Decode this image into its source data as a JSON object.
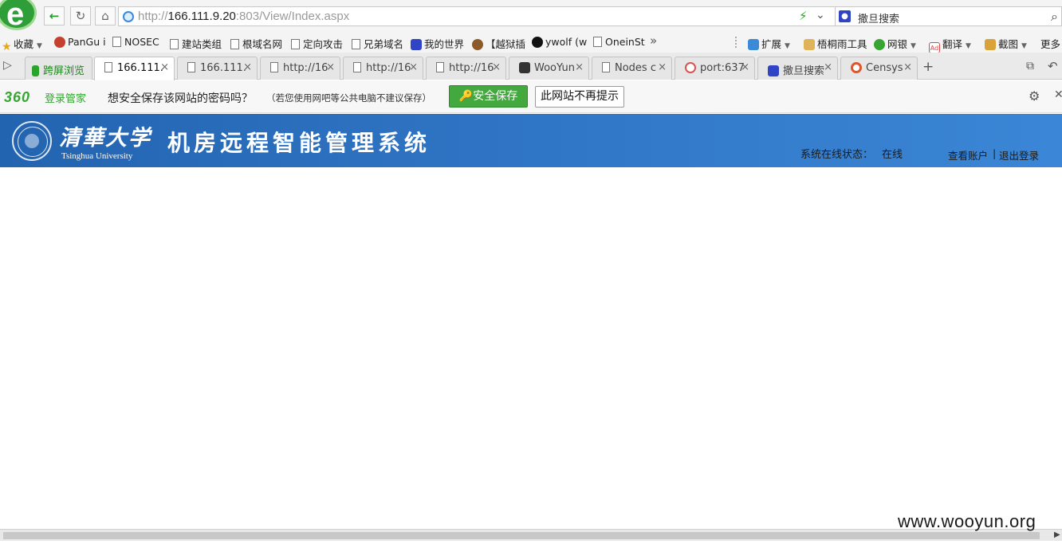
{
  "browser": {
    "logo_glyph": "e",
    "url_scheme": "http://",
    "url_host": "166.111.9.20",
    "url_rest": ":803/View/Index.aspx",
    "search_text": "撒旦搜索",
    "icons": [
      "back-icon",
      "refresh-icon",
      "home-icon",
      "globe-icon",
      "lightning-icon",
      "chevron-down-icon",
      "search-icon"
    ]
  },
  "bookmarks": {
    "left": [
      "收藏",
      "PanGu i",
      "NOSEC",
      "建站类组",
      "根域名网",
      "定向攻击",
      "兄弟域名",
      "我的世界",
      "【越狱插",
      "ywolf (w",
      "OneinSt"
    ],
    "more_glyph": "»",
    "right": [
      "扩展",
      "梧桐雨工具",
      "网银",
      "翻译",
      "截图",
      "更多"
    ]
  },
  "tabs": {
    "split_view": "跨屏浏览",
    "items": [
      {
        "title": "166.111.",
        "active": true
      },
      {
        "title": "166.111."
      },
      {
        "title": "http://16"
      },
      {
        "title": "http://16"
      },
      {
        "title": "http://16"
      },
      {
        "title": "WooYun"
      },
      {
        "title": "Nodes c"
      },
      {
        "title": "port:637"
      },
      {
        "title": "撒旦搜索"
      },
      {
        "title": "Censys"
      }
    ],
    "close_glyph": "×",
    "new_tab_glyph": "+"
  },
  "password_bar": {
    "brand": "360",
    "brand_sub": "登录管家",
    "question": "想安全保存该网站的密码吗？",
    "note": "（若您使用网吧等公共电脑不建议保存）",
    "save_label": "安全保存",
    "dismiss_label": "此网站不再提示"
  },
  "page": {
    "university_cn": "清華大学",
    "university_en": "Tsinghua University",
    "system_title": "机房远程智能管理系统",
    "status_label": "系统在线状态：",
    "status_value": "在线",
    "account_link": "查看账户",
    "separator": "|",
    "logout_link": "退出登录",
    "header_colors": [
      "#2364b0",
      "#3b86d6"
    ]
  },
  "watermark": "www.wooyun.org",
  "colors": {
    "accent_green": "#43a83e",
    "brand_360_green": "#37a532",
    "header_blue": "#2f74c4"
  }
}
